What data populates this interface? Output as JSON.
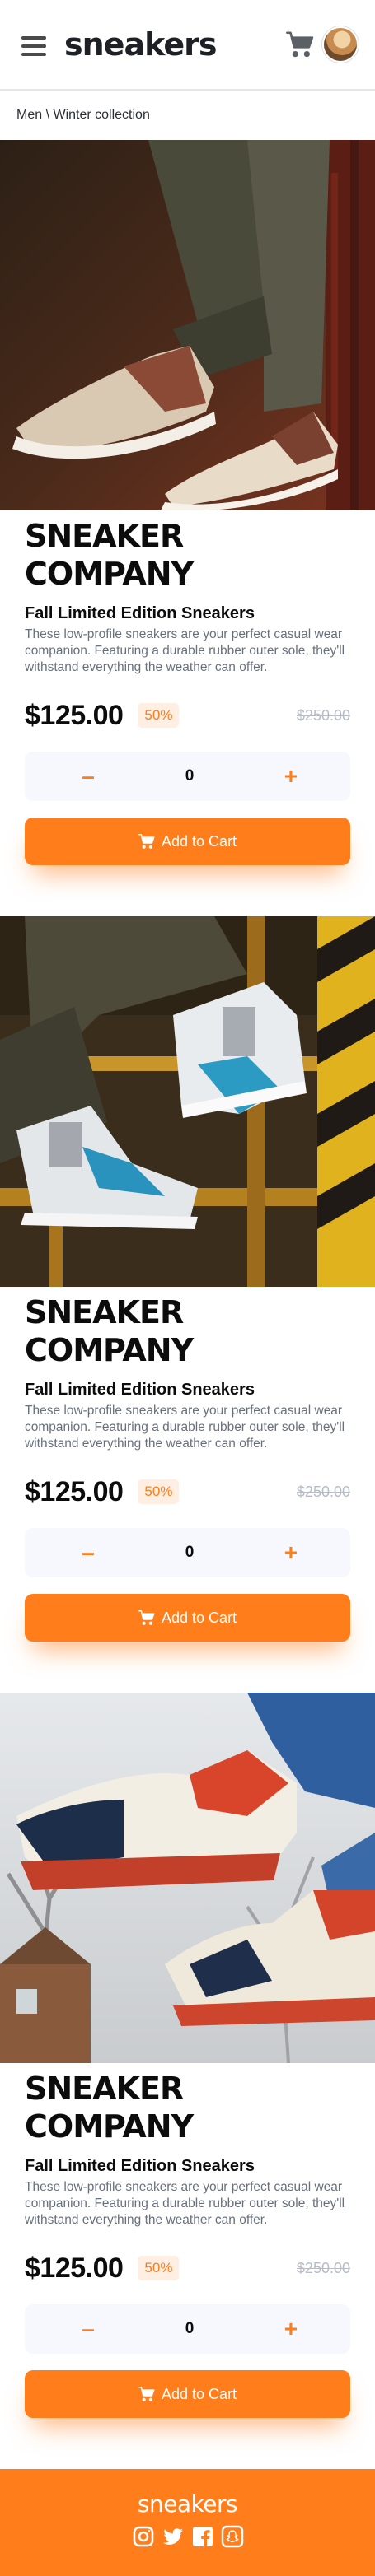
{
  "header": {
    "logo": "sneakers",
    "menu_icon": "menu-icon",
    "cart_icon": "cart-icon",
    "avatar": "avatar"
  },
  "breadcrumb": "Men \\ Winter collection",
  "products": [
    {
      "image": "sneaker-photo-1",
      "company": "SNEAKER COMPANY",
      "name": "Fall Limited Edition Sneakers",
      "description": "These low-profile sneakers are your perfect casual wear companion. Featuring a durable rubber outer sole, they'll withstand everything the weather can offer.",
      "price": "$125.00",
      "discount": "50%",
      "old_price": "$250.00",
      "minus": "–",
      "quantity": "0",
      "plus": "+",
      "add_label": "Add to Cart"
    },
    {
      "image": "sneaker-photo-2",
      "company": "SNEAKER COMPANY",
      "name": "Fall Limited Edition Sneakers",
      "description": "These low-profile sneakers are your perfect casual wear companion. Featuring a durable rubber outer sole, they'll withstand everything the weather can offer.",
      "price": "$125.00",
      "discount": "50%",
      "old_price": "$250.00",
      "minus": "–",
      "quantity": "0",
      "plus": "+",
      "add_label": "Add to Cart"
    },
    {
      "image": "sneaker-photo-3",
      "company": "SNEAKER COMPANY",
      "name": "Fall Limited Edition Sneakers",
      "description": "These low-profile sneakers are your perfect casual wear companion. Featuring a durable rubber outer sole, they'll withstand everything the weather can offer.",
      "price": "$125.00",
      "discount": "50%",
      "old_price": "$250.00",
      "minus": "–",
      "quantity": "0",
      "plus": "+",
      "add_label": "Add to Cart"
    }
  ],
  "footer": {
    "logo": "sneakers",
    "social": [
      "instagram-icon",
      "twitter-icon",
      "facebook-icon",
      "snapchat-icon"
    ]
  },
  "colors": {
    "accent": "#ff7d1a",
    "accent_pale": "#ffeee2",
    "text_dark": "#1d2025",
    "text_gray": "#68707d"
  }
}
